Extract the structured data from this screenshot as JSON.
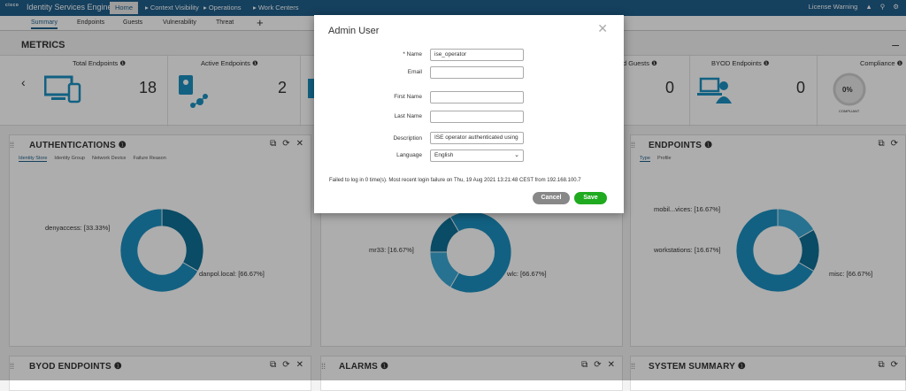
{
  "topbar": {
    "logo": "cisco",
    "product": "Identity Services Engine",
    "nav": [
      "Home",
      "▸ Context Visibility",
      "▸ Operations",
      "▸ Work Centers"
    ],
    "right": [
      "License Warning",
      "▲",
      "⚲",
      "⚙"
    ]
  },
  "subtabs": [
    "Summary",
    "Endpoints",
    "Guests",
    "Vulnerability",
    "Threat"
  ],
  "plus": "+",
  "metrics": {
    "title": "METRICS",
    "collapse": "–",
    "prev": "‹",
    "items": [
      {
        "label": "Total Endpoints ❶",
        "value": "18"
      },
      {
        "label": "Active Endpoints ❶",
        "value": "2"
      },
      {
        "label": "d Guests ❶",
        "value": "0"
      },
      {
        "label": "BYOD Endpoints ❶",
        "value": "0"
      },
      {
        "label": "Compliance ❶",
        "value": "0%",
        "sub": "COMPLIANT"
      }
    ]
  },
  "dashlets": {
    "authentications": {
      "title": "AUTHENTICATIONS ❶",
      "tabs": [
        "Identity Store",
        "Identity Group",
        "Network Device",
        "Failure Reason"
      ],
      "legend": [
        "denyaccess: [33.33%]",
        "danpol.local: [66.67%]"
      ],
      "values": [
        33.33,
        66.67
      ]
    },
    "middle": {
      "legend": [
        "mr33: [16.67%]",
        "wlc: [66.67%]"
      ],
      "values": [
        16.67,
        66.67,
        16.66
      ]
    },
    "endpoints": {
      "title": "ENDPOINTS ❶",
      "tabs": [
        "Type",
        "Profile"
      ],
      "legend": [
        "mobil...vices: [16.67%]",
        "workstations: [16.67%]",
        "misc: [66.67%]"
      ],
      "values": [
        16.67,
        16.67,
        66.67
      ]
    },
    "byod": {
      "title": "BYOD ENDPOINTS ❶"
    },
    "alarms": {
      "title": "ALARMS ❶"
    },
    "system": {
      "title": "SYSTEM SUMMARY ❶"
    },
    "tools": [
      "⧉",
      "⟳",
      "✕"
    ]
  },
  "modal": {
    "title": "Admin User",
    "close": "✕",
    "fields": {
      "name_label": "* Name",
      "name_value": "ise_operator",
      "email_label": "Email",
      "email_value": "",
      "first_label": "First Name",
      "first_value": "",
      "last_label": "Last Name",
      "last_value": "",
      "desc_label": "Description",
      "desc_value": "ISE operator authenticated using",
      "lang_label": "Language",
      "lang_value": "English"
    },
    "note": "Failed to log in 0 time(s). Most recent login failure on Thu, 19 Aug 2021 13:21:48 CEST from 192.168.100.7",
    "cancel": "Cancel",
    "save": "Save"
  },
  "colors": {
    "accent": "#1f5f8b",
    "save": "#1faa1f",
    "donut_dark": "#0f6f95",
    "donut_mid": "#1b8fc0",
    "donut_light": "#3aa9d4"
  }
}
